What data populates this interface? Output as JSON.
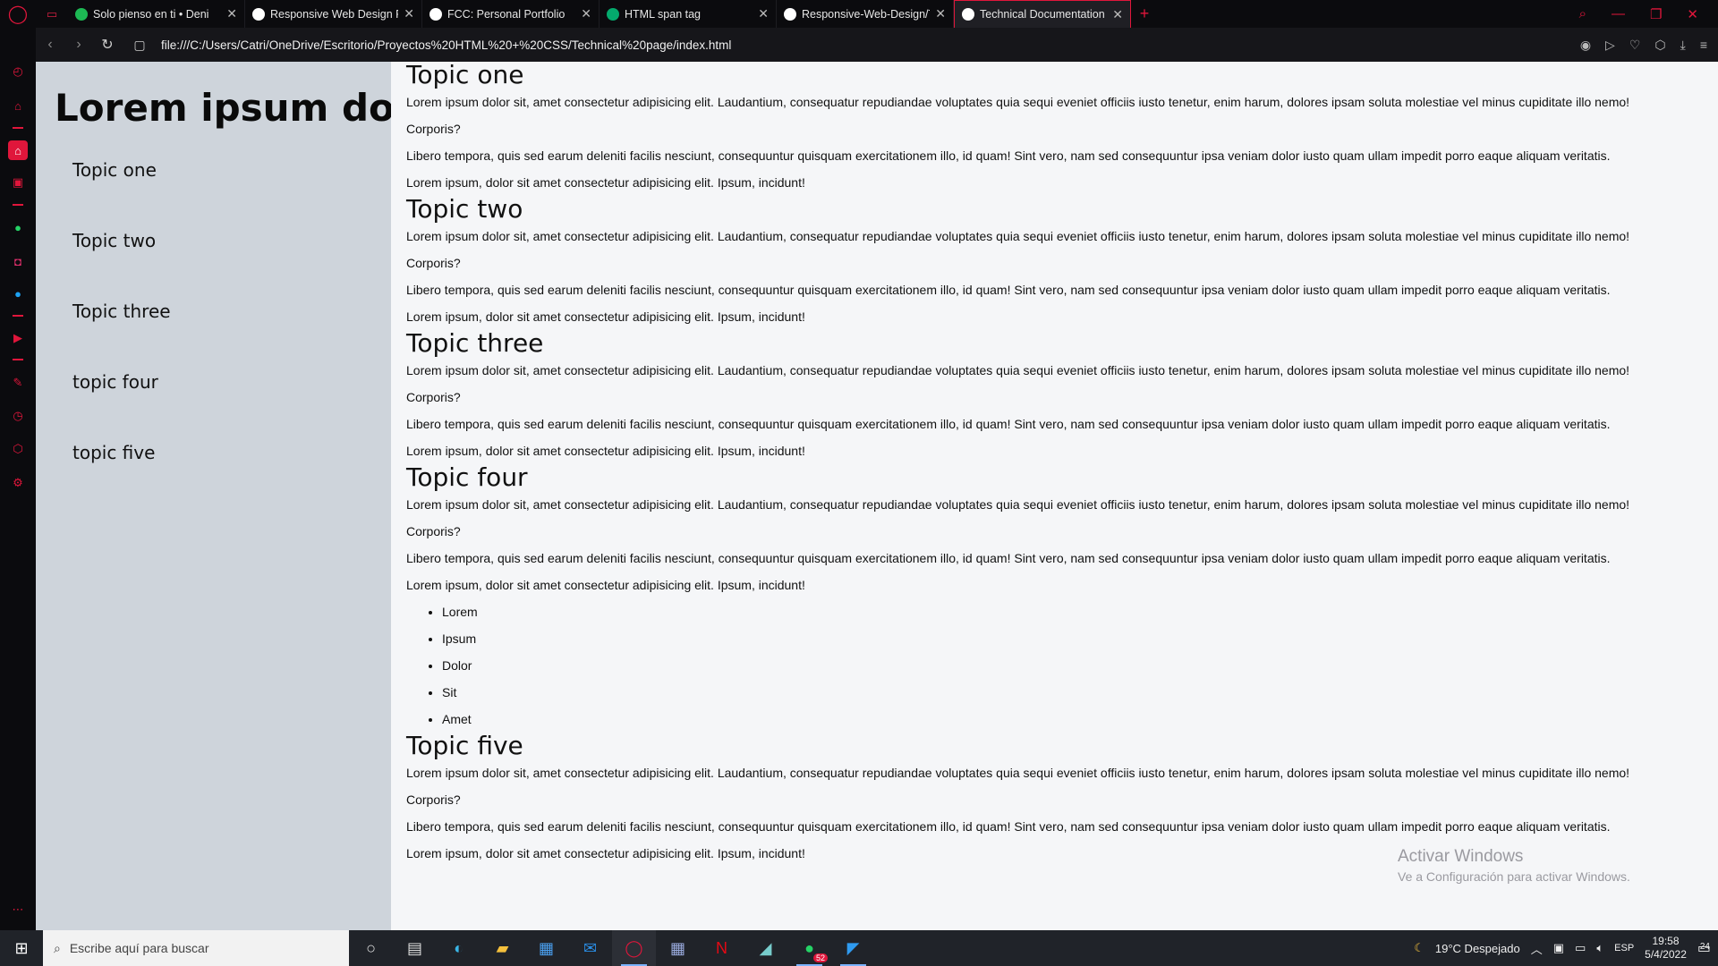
{
  "browser": {
    "tabs": [
      {
        "title": "Solo pienso en ti • Deni",
        "favicon": "spotify-icon",
        "color": "#1db954"
      },
      {
        "title": "Responsive Web Design Pr",
        "favicon": "freecodecamp-icon",
        "color": "#ffffff"
      },
      {
        "title": "FCC: Personal Portfolio",
        "favicon": "codepen-icon",
        "color": "#ffffff"
      },
      {
        "title": "HTML span tag",
        "favicon": "w3schools-icon",
        "color": "#04aa6d"
      },
      {
        "title": "Responsive-Web-Design/Te",
        "favicon": "github-icon",
        "color": "#ffffff"
      },
      {
        "title": "Technical Documentation p",
        "favicon": "globe-icon",
        "color": "#ffffff",
        "active": true
      }
    ],
    "url": "file:///C:/Users/Catri/OneDrive/Escritorio/Proyectos%20HTML%20+%20CSS/Technical%20page/index.html",
    "accent": "#e0163b"
  },
  "page": {
    "nav_title": "Lorem ipsum dolor sit amet.",
    "nav_links": [
      "Topic one",
      "Topic two",
      "Topic three",
      "topic four",
      "topic five"
    ],
    "sections": [
      {
        "title": "Topic one",
        "paragraphs": [
          "Lorem ipsum dolor sit, amet consectetur adipisicing elit. Laudantium, consequatur repudiandae voluptates quia sequi eveniet officiis iusto tenetur, enim harum, dolores ipsam soluta molestiae vel minus cupiditate illo nemo!",
          "Corporis?",
          "Libero tempora, quis sed earum deleniti facilis nesciunt, consequuntur quisquam exercitationem illo, id quam! Sint vero, nam sed consequuntur ipsa veniam dolor iusto quam ullam impedit porro eaque aliquam veritatis.",
          "Lorem ipsum, dolor sit amet consectetur adipisicing elit. Ipsum, incidunt!"
        ]
      },
      {
        "title": "Topic two",
        "paragraphs": [
          "Lorem ipsum dolor sit, amet consectetur adipisicing elit. Laudantium, consequatur repudiandae voluptates quia sequi eveniet officiis iusto tenetur, enim harum, dolores ipsam soluta molestiae vel minus cupiditate illo nemo!",
          "Corporis?",
          "Libero tempora, quis sed earum deleniti facilis nesciunt, consequuntur quisquam exercitationem illo, id quam! Sint vero, nam sed consequuntur ipsa veniam dolor iusto quam ullam impedit porro eaque aliquam veritatis.",
          "Lorem ipsum, dolor sit amet consectetur adipisicing elit. Ipsum, incidunt!"
        ]
      },
      {
        "title": "Topic three",
        "paragraphs": [
          "Lorem ipsum dolor sit, amet consectetur adipisicing elit. Laudantium, consequatur repudiandae voluptates quia sequi eveniet officiis iusto tenetur, enim harum, dolores ipsam soluta molestiae vel minus cupiditate illo nemo!",
          "Corporis?",
          "Libero tempora, quis sed earum deleniti facilis nesciunt, consequuntur quisquam exercitationem illo, id quam! Sint vero, nam sed consequuntur ipsa veniam dolor iusto quam ullam impedit porro eaque aliquam veritatis.",
          "Lorem ipsum, dolor sit amet consectetur adipisicing elit. Ipsum, incidunt!"
        ]
      },
      {
        "title": "Topic four",
        "paragraphs": [
          "Lorem ipsum dolor sit, amet consectetur adipisicing elit. Laudantium, consequatur repudiandae voluptates quia sequi eveniet officiis iusto tenetur, enim harum, dolores ipsam soluta molestiae vel minus cupiditate illo nemo!",
          "Corporis?",
          "Libero tempora, quis sed earum deleniti facilis nesciunt, consequuntur quisquam exercitationem illo, id quam! Sint vero, nam sed consequuntur ipsa veniam dolor iusto quam ullam impedit porro eaque aliquam veritatis.",
          "Lorem ipsum, dolor sit amet consectetur adipisicing elit. Ipsum, incidunt!"
        ],
        "list": [
          "Lorem",
          "Ipsum",
          "Dolor",
          "Sit",
          "Amet"
        ]
      },
      {
        "title": "Topic five",
        "paragraphs": [
          "Lorem ipsum dolor sit, amet consectetur adipisicing elit. Laudantium, consequatur repudiandae voluptates quia sequi eveniet officiis iusto tenetur, enim harum, dolores ipsam soluta molestiae vel minus cupiditate illo nemo!",
          "Corporis?",
          "Libero tempora, quis sed earum deleniti facilis nesciunt, consequuntur quisquam exercitationem illo, id quam! Sint vero, nam sed consequuntur ipsa veniam dolor iusto quam ullam impedit porro eaque aliquam veritatis.",
          "Lorem ipsum, dolor sit amet consectetur adipisicing elit. Ipsum, incidunt!"
        ]
      }
    ],
    "watermark": {
      "title": "Activar Windows",
      "subtitle": "Ve a Configuración para activar Windows."
    }
  },
  "taskbar": {
    "search_placeholder": "Escribe aquí para buscar",
    "weather": "19°C  Despejado",
    "language": "ESP",
    "time": "19:58",
    "date": "5/4/2022",
    "whatsapp_badge": "52",
    "notification_count": "24"
  }
}
